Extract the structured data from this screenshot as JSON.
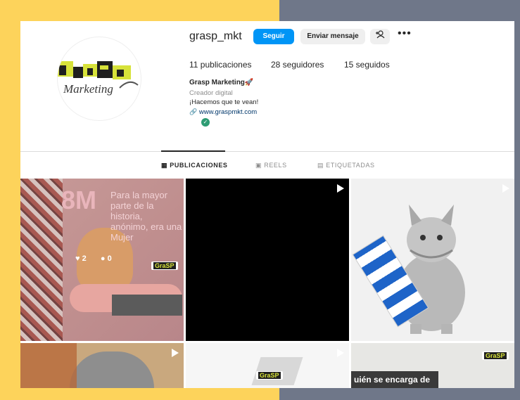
{
  "profile": {
    "username": "grasp_mkt",
    "follow_label": "Seguir",
    "message_label": "Enviar mensaje",
    "more_label": "•••",
    "add_user_icon": "+♕",
    "stats": {
      "posts": "11 publicaciones",
      "followers": "28 seguidores",
      "following": "15 seguidos"
    },
    "bio": {
      "name": "Grasp Marketing🚀",
      "category": "Creador digital",
      "text": "¡Hacemos que te vean!",
      "link": "www.graspmkt.com"
    },
    "logo": {
      "word1": "GraSP",
      "word2": "Marketing"
    }
  },
  "tabs": [
    {
      "label": "PUBLICACIONES",
      "icon": "grid-icon"
    },
    {
      "label": "REELS",
      "icon": "reels-icon"
    },
    {
      "label": "ETIQUETADAS",
      "icon": "tag-icon"
    }
  ],
  "posts": {
    "p1": {
      "headline": "8M",
      "text": "Para la mayor parte de la historia, anónimo, era una Mujer",
      "likes": "2",
      "comments": "0"
    },
    "p6": {
      "caption": "uién se encarga de"
    }
  },
  "colors": {
    "accent": "#0095f6",
    "bg_yellow": "#fdd35b",
    "bg_gray": "#6f7789",
    "verified": "#2e9c74"
  }
}
